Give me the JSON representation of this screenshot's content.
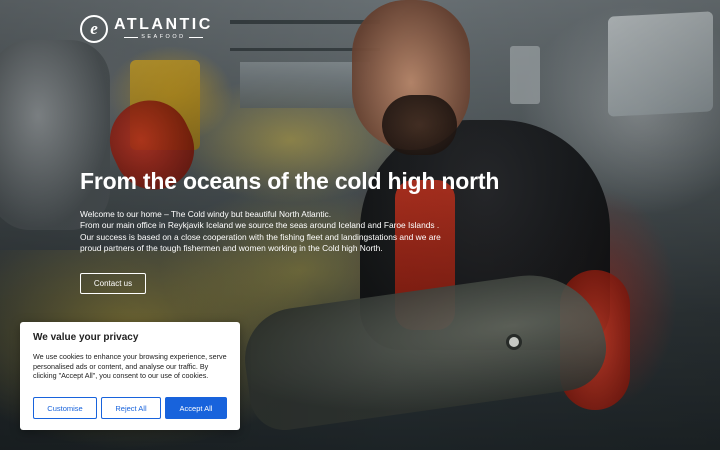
{
  "brand": {
    "logo_letter": "e",
    "name": "ATLANTIC",
    "sub": "SEAFOOD"
  },
  "hero": {
    "headline": "From the oceans of the cold high north",
    "intro_lines": [
      "Welcome to our home – The Cold windy but beautiful North Atlantic.",
      "From our main office in Reykjavik Iceland we source the seas around Iceland and Faroe Islands .",
      "Our success is based on a close cooperation with the fishing fleet and landingstations and we are",
      "proud partners of the tough fishermen and women working in the Cold high North."
    ],
    "cta_label": "Contact us"
  },
  "cookie_banner": {
    "title": "We value your privacy",
    "text": "We use cookies to enhance your browsing experience, serve personalised ads or content, and analyse our traffic. By clicking \"Accept All\", you consent to our use of cookies.",
    "customise_label": "Customise",
    "reject_label": "Reject All",
    "accept_label": "Accept All",
    "accent_color": "#1863dc"
  }
}
